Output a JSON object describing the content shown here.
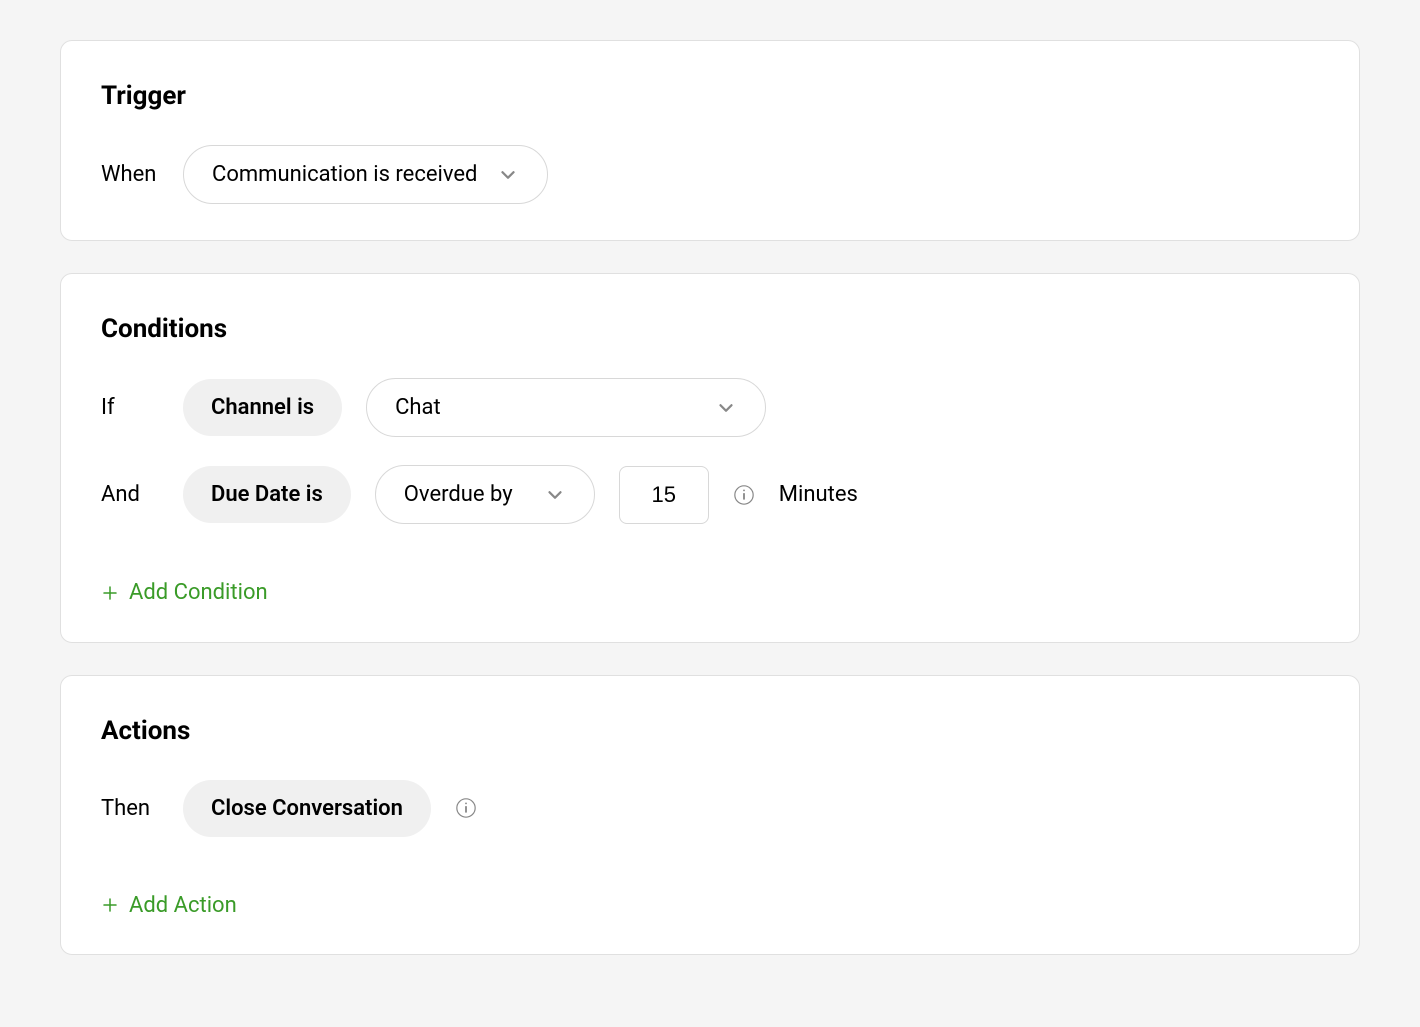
{
  "trigger": {
    "title": "Trigger",
    "when_label": "When",
    "when_value": "Communication is received"
  },
  "conditions": {
    "title": "Conditions",
    "rows": [
      {
        "prefix": "If",
        "field": "Channel is",
        "value": "Chat"
      },
      {
        "prefix": "And",
        "field": "Due Date is",
        "operator": "Overdue by",
        "number": "15",
        "unit": "Minutes"
      }
    ],
    "add_label": "Add Condition"
  },
  "actions": {
    "title": "Actions",
    "then_label": "Then",
    "action_value": "Close Conversation",
    "add_label": "Add Action"
  }
}
